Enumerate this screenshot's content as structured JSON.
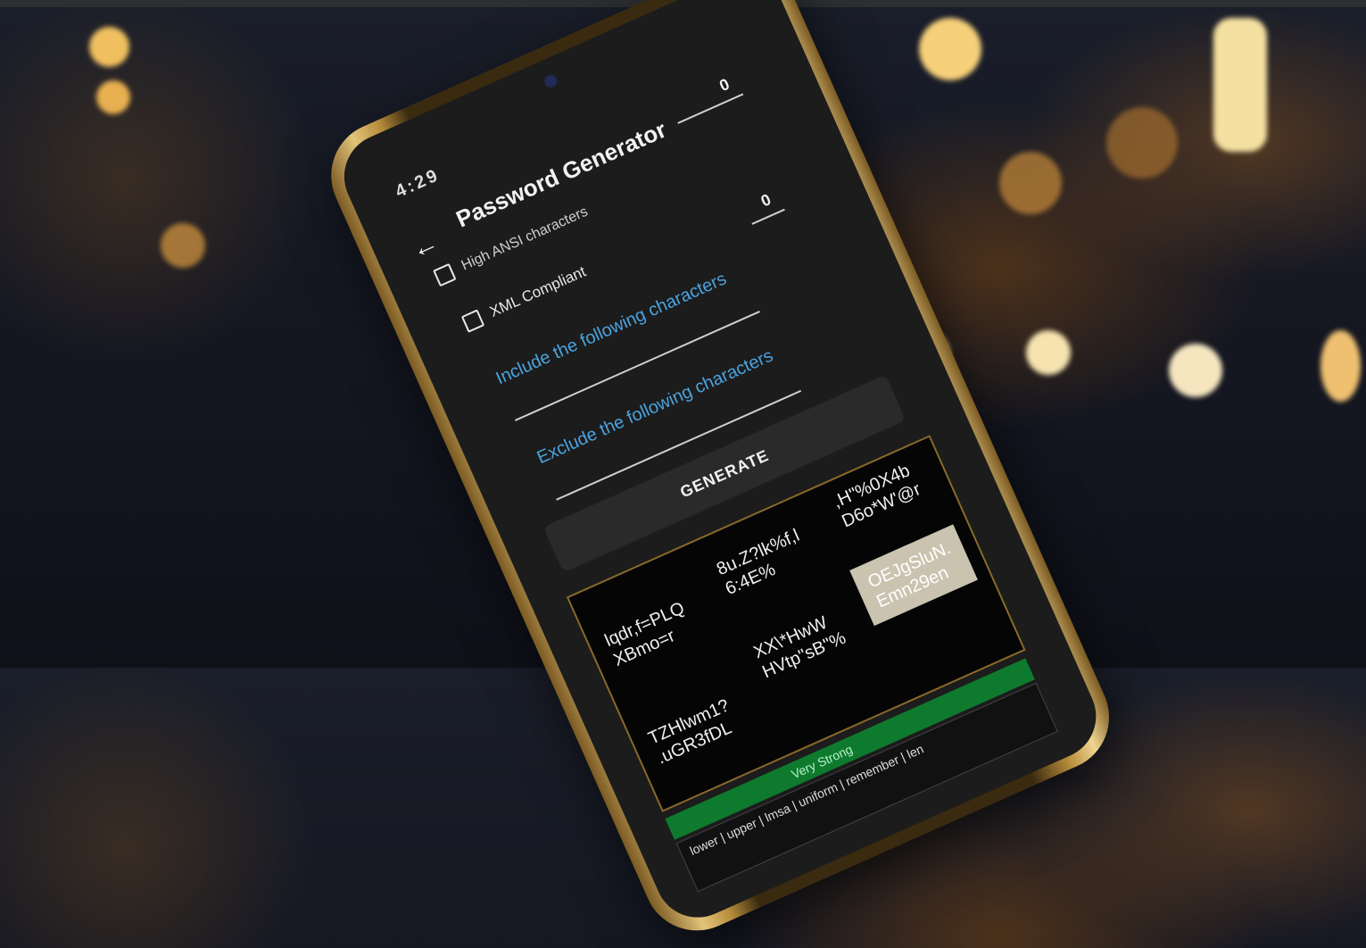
{
  "status_bar": {
    "time": "4:29"
  },
  "app": {
    "title": "Password Generator",
    "back_icon": "back-arrow-icon"
  },
  "options": {
    "high_ansi": {
      "label": "High ANSI characters",
      "checked": false
    },
    "high_ansi_value": "0",
    "xml_compliant": {
      "label": "XML Compliant",
      "checked": false
    },
    "include_value": "0",
    "include_label": "Include the following characters",
    "exclude_label": "Exclude the following characters"
  },
  "generate_button": "GENERATE",
  "passwords": [
    {
      "line1": "lqdr,f=PLQ",
      "line2": "XBmo=r"
    },
    {
      "line1": "8u.Z?lk%f,l",
      "line2": "6:4E%"
    },
    {
      "line1": ",H\"%0X4b",
      "line2": "D6o*W'@r"
    },
    {
      "line1": "OEJgSluN.",
      "line2": "Emn29en",
      "selected": true
    },
    {
      "line1": "XX\\*HwW",
      "line2": "HVtp\"sB\"%"
    },
    {
      "line1": "TZHlwm1?",
      "line2": ".uGR3fDL"
    }
  ],
  "strength": "Very Strong",
  "info": "lower | upper | lmsa | uniform | remember | len",
  "colors": {
    "accent": "#4aa3df",
    "strength_green": "#0e7a2e",
    "frame_gold": "#c9a45a"
  }
}
